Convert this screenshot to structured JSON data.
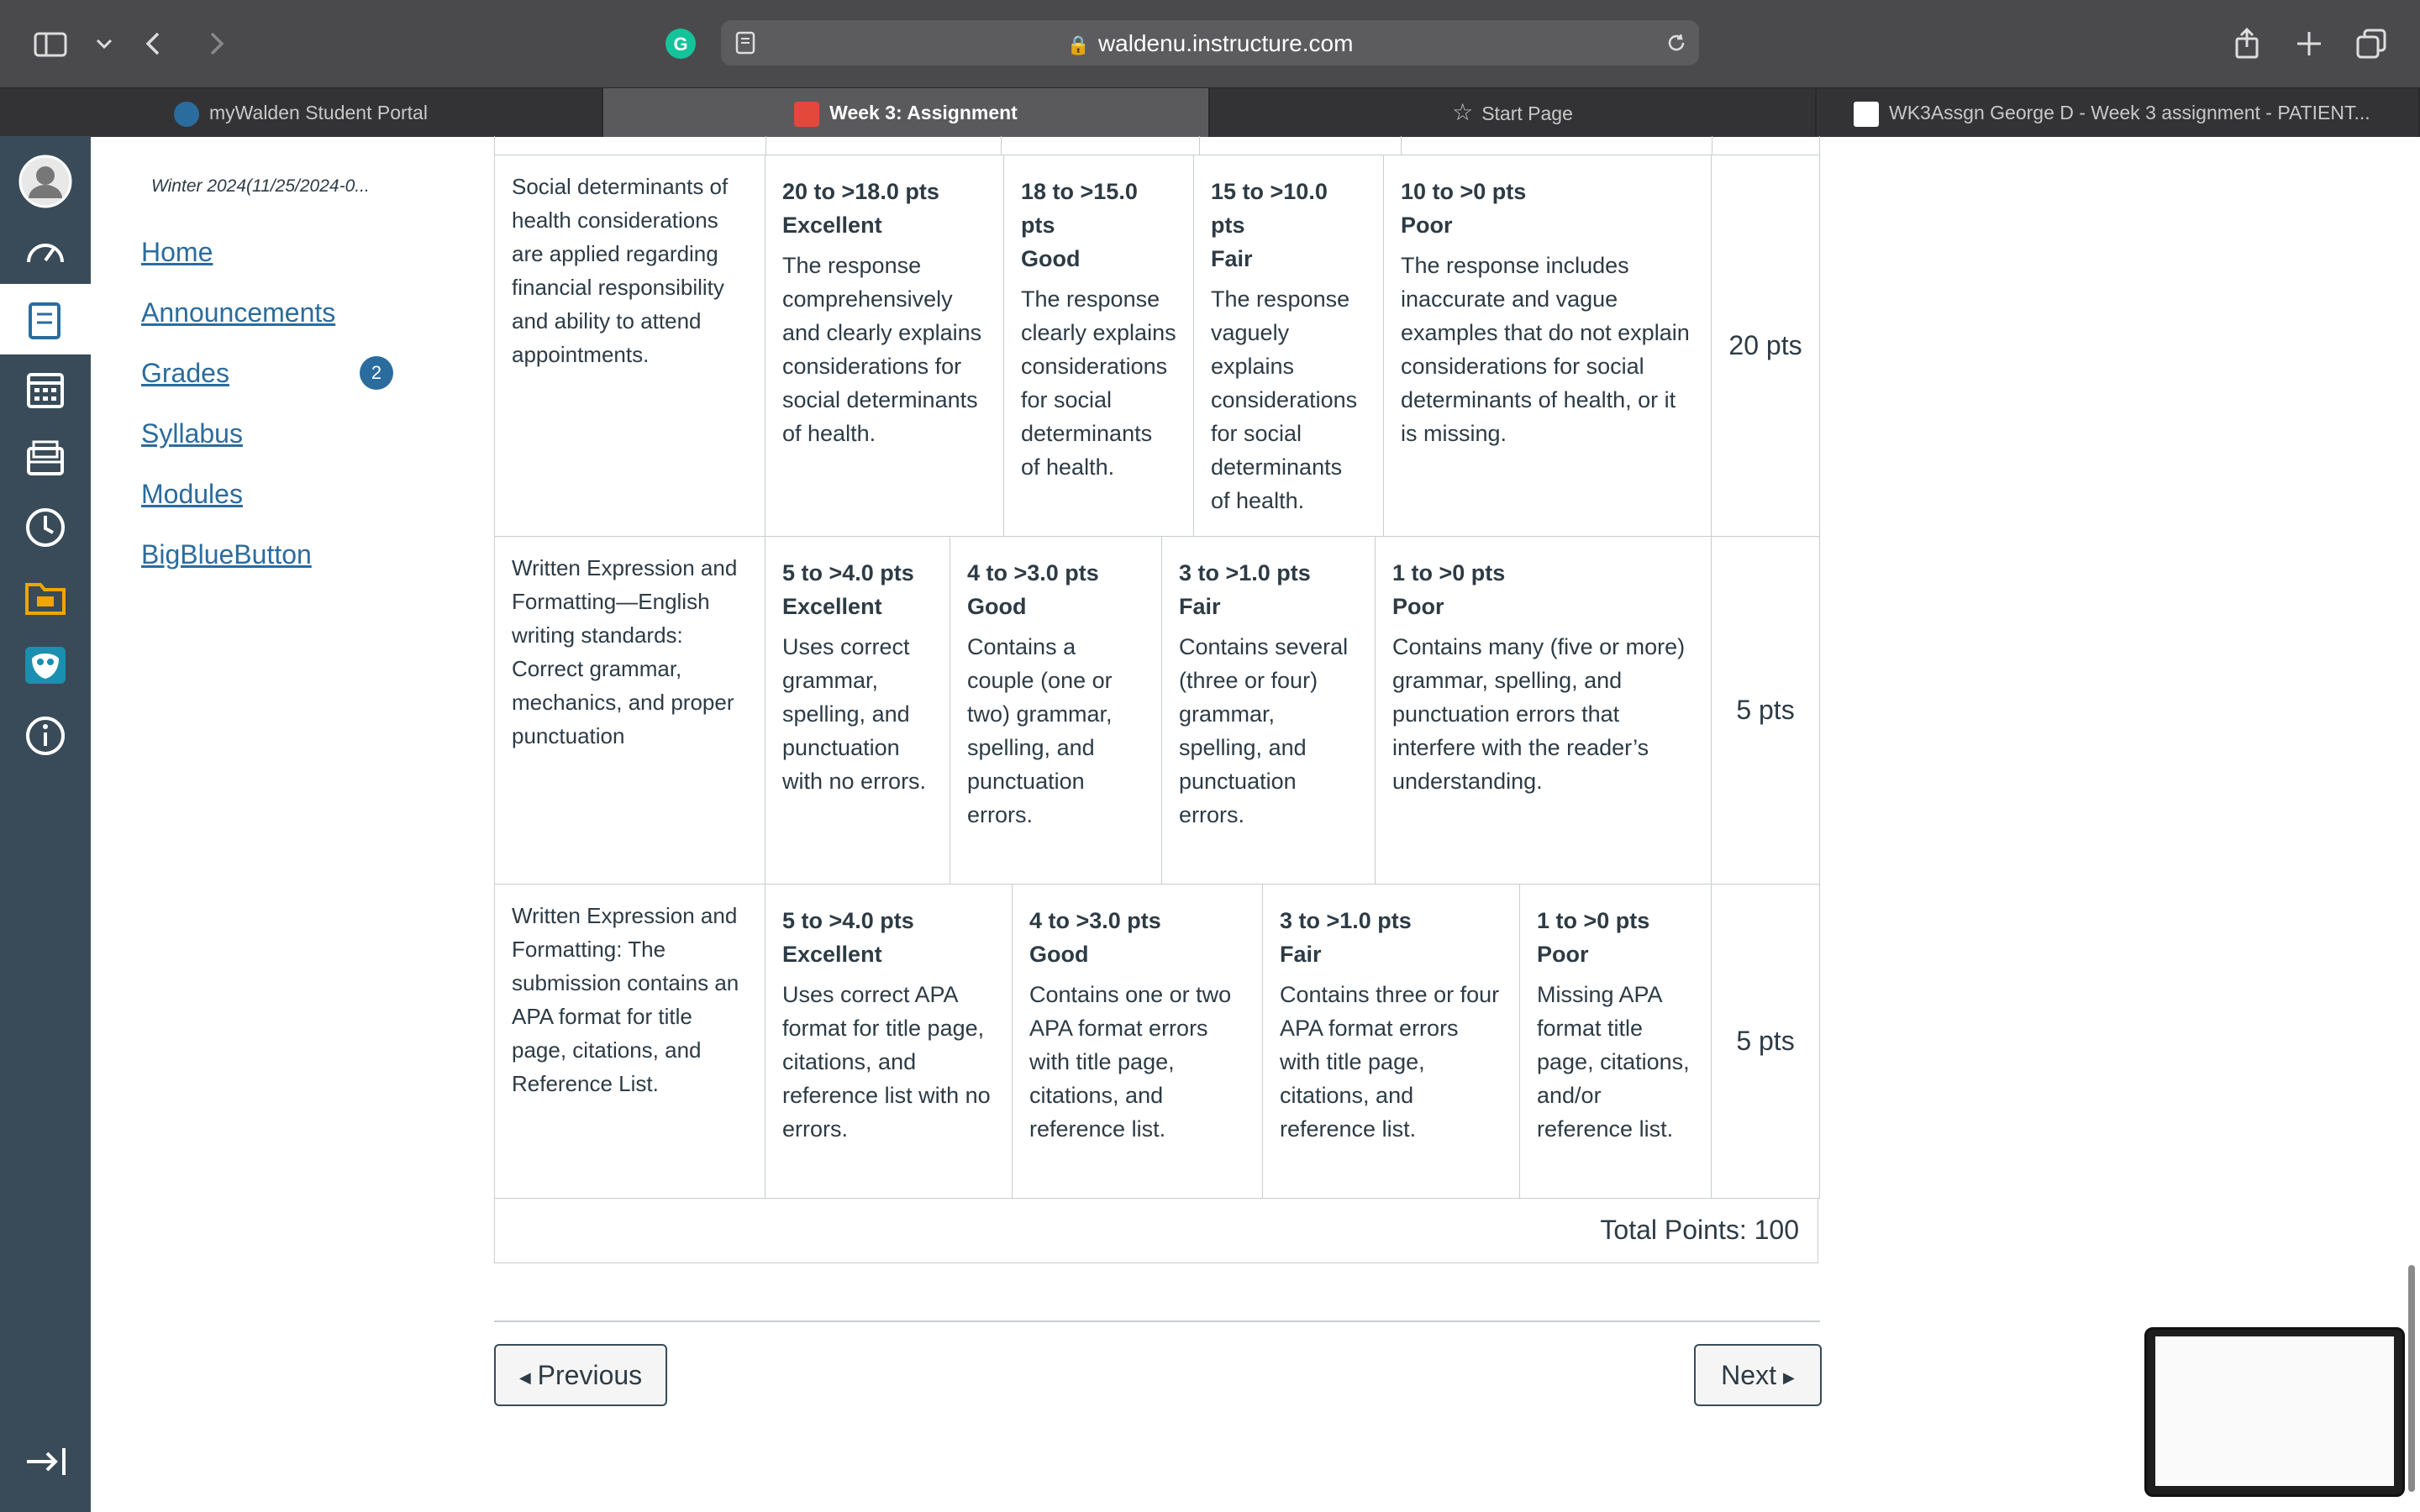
{
  "browser": {
    "url": "waldenu.instructure.com",
    "tabs": [
      {
        "label": "myWalden Student Portal",
        "active": false
      },
      {
        "label": "Week 3: Assignment",
        "active": true
      },
      {
        "label": "Start Page",
        "active": false
      },
      {
        "label": "WK3Assgn George D - Week 3 assignment - PATIENT...",
        "active": false
      }
    ]
  },
  "course": {
    "title": "Winter 2024(11/25/2024-0...",
    "nav": [
      {
        "label": "Home"
      },
      {
        "label": "Announcements"
      },
      {
        "label": "Grades",
        "badge": "2"
      },
      {
        "label": "Syllabus"
      },
      {
        "label": "Modules"
      },
      {
        "label": "BigBlueButton"
      }
    ]
  },
  "rubric": {
    "rows": [
      {
        "criterion": "Social determinants of health considerations are applied regarding financial responsibility and ability to attend appointments.",
        "points": "20 pts",
        "ratings": [
          {
            "pts": "20 to >18.0 pts",
            "level": "Excellent",
            "desc": "The response comprehensively and clearly explains considerations for social determinants of health."
          },
          {
            "pts": "18 to >15.0 pts",
            "level": "Good",
            "desc": "The response clearly explains considerations for social determinants of health."
          },
          {
            "pts": "15 to >10.0 pts",
            "level": "Fair",
            "desc": "The response vaguely explains considerations for social determinants of health."
          },
          {
            "pts": "10 to >0 pts",
            "level": "Poor",
            "desc": "The response includes inaccurate and vague examples that do not explain considerations for social determinants of health, or it is missing."
          }
        ]
      },
      {
        "criterion": "Written Expression and Formatting—English writing standards: Correct grammar, mechanics, and proper punctuation",
        "points": "5 pts",
        "ratings": [
          {
            "pts": "5 to >4.0 pts",
            "level": "Excellent",
            "desc": "Uses correct grammar, spelling, and punctuation with no errors."
          },
          {
            "pts": "4 to >3.0 pts",
            "level": "Good",
            "desc": "Contains a couple (one or two) grammar, spelling, and punctuation errors."
          },
          {
            "pts": "3 to >1.0 pts",
            "level": "Fair",
            "desc": "Contains several (three or four) grammar, spelling, and punctuation errors."
          },
          {
            "pts": "1 to >0 pts",
            "level": "Poor",
            "desc": "Contains many (five or more) grammar, spelling, and punctuation errors that interfere with the reader’s understanding."
          }
        ]
      },
      {
        "criterion": "Written Expression and Formatting: The submission contains an APA format for title page, citations, and Reference List.",
        "points": "5 pts",
        "ratings": [
          {
            "pts": "5 to >4.0 pts",
            "level": "Excellent",
            "desc": "Uses correct APA format for title page, citations, and reference list with no errors."
          },
          {
            "pts": "4 to >3.0 pts",
            "level": "Good",
            "desc": "Contains one or two APA format errors with title page, citations, and reference list."
          },
          {
            "pts": "3 to >1.0 pts",
            "level": "Fair",
            "desc": "Contains three or four APA format errors with title page, citations, and reference list."
          },
          {
            "pts": "1 to >0 pts",
            "level": "Poor",
            "desc": "Missing APA format title page, citations, and/or reference list."
          }
        ]
      }
    ],
    "total": "Total Points: 100"
  },
  "pager": {
    "previous": "Previous",
    "next": "Next"
  },
  "colors": {
    "nav_bg": "#394b58",
    "link": "#2b6c9e"
  }
}
